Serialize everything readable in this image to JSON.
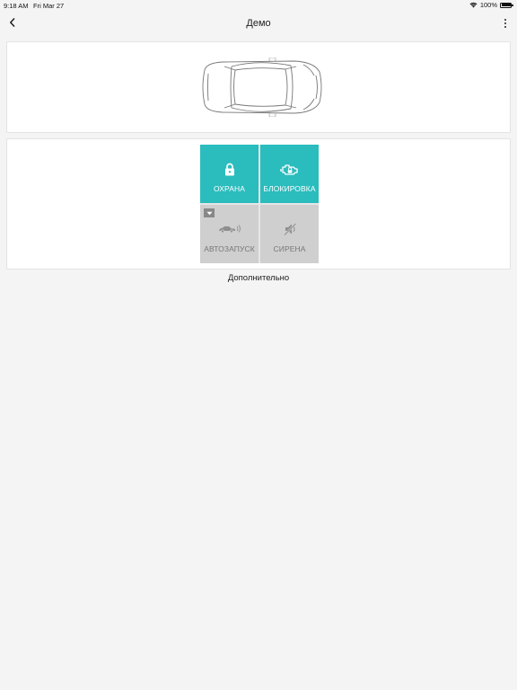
{
  "status_bar": {
    "time": "9:18 AM",
    "date": "Fri Mar 27",
    "battery": "100%"
  },
  "nav": {
    "title": "Демо"
  },
  "tiles": [
    {
      "label": "ОХРАНА",
      "icon": "lock-icon",
      "state": "active"
    },
    {
      "label": "БЛОКИРОВКА",
      "icon": "engine-lock-icon",
      "state": "active"
    },
    {
      "label": "АВТОЗАПУСК",
      "icon": "remote-start-icon",
      "state": "inactive"
    },
    {
      "label": "СИРЕНА",
      "icon": "siren-muted-icon",
      "state": "inactive"
    }
  ],
  "more_label": "Дополнительно",
  "colors": {
    "active": "#2bbcbd",
    "inactive": "#cfcfcf",
    "background": "#f4f4f4"
  }
}
